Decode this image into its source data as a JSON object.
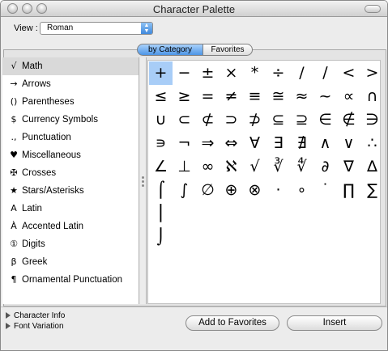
{
  "window": {
    "title": "Character Palette"
  },
  "view": {
    "label": "View :",
    "selected": "Roman"
  },
  "tabs": [
    {
      "label": "by Category",
      "active": true
    },
    {
      "label": "Favorites",
      "active": false
    }
  ],
  "categories": [
    {
      "icon": "√",
      "label": "Math",
      "selected": true
    },
    {
      "icon": "→",
      "label": "Arrows"
    },
    {
      "icon": "()",
      "label": "Parentheses"
    },
    {
      "icon": "$",
      "label": "Currency Symbols"
    },
    {
      "icon": ".,",
      "label": "Punctuation"
    },
    {
      "icon": "♥",
      "label": "Miscellaneous"
    },
    {
      "icon": "✠",
      "label": "Crosses"
    },
    {
      "icon": "★",
      "label": "Stars/Asterisks"
    },
    {
      "icon": "A",
      "label": "Latin"
    },
    {
      "icon": "À",
      "label": "Accented Latin"
    },
    {
      "icon": "①",
      "label": "Digits"
    },
    {
      "icon": "β",
      "label": "Greek"
    },
    {
      "icon": "¶",
      "label": "Ornamental Punctuation"
    }
  ],
  "glyphs": [
    [
      "+",
      "−",
      "±",
      "×",
      "*",
      "÷",
      "/",
      "∕",
      "<",
      ">"
    ],
    [
      "≤",
      "≥",
      "=",
      "≠",
      "≡",
      "≅",
      "≈",
      "~",
      "∝",
      "∩"
    ],
    [
      "∪",
      "⊂",
      "⊄",
      "⊃",
      "⊅",
      "⊆",
      "⊇",
      "∈",
      "∉",
      "∋"
    ],
    [
      "∍",
      "¬",
      "⇒",
      "⇔",
      "∀",
      "∃",
      "∄",
      "∧",
      "∨",
      "∴"
    ],
    [
      "∠",
      "⊥",
      "∞",
      "ℵ",
      "√",
      "∛",
      "∜",
      "∂",
      "∇",
      "∆"
    ],
    [
      "⌠",
      "∫",
      "∅",
      "⊕",
      "⊗",
      "·",
      "∘",
      "˙",
      "∏",
      "∑"
    ],
    [
      "⎮",
      "",
      "",
      "",
      "",
      "",
      "",
      "",
      "",
      ""
    ],
    [
      "⌡",
      "",
      "",
      "",
      "",
      "",
      "",
      "",
      "",
      ""
    ]
  ],
  "footer": {
    "character_info": "Character Info",
    "font_variation": "Font Variation",
    "add_to_favorites": "Add to Favorites",
    "insert": "Insert"
  },
  "colors": {
    "selection": "#a8cdf7",
    "accent": "#4d96e6"
  }
}
